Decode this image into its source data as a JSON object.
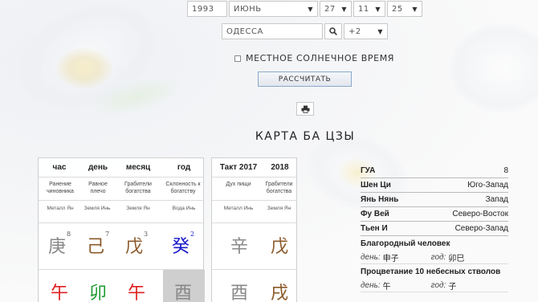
{
  "form": {
    "year": "1993",
    "month": "ИЮНЬ",
    "day": "27",
    "hour": "11",
    "minute": "25",
    "city": "ОДЕССА",
    "timezone": "+2",
    "local_solar_time_label": "МЕСТНОЕ СОЛНЕЧНОЕ ВРЕМЯ",
    "calculate_label": "РАССЧИТАТЬ"
  },
  "chart_title": "КАРТА БА ЦЗЫ",
  "pillars": {
    "headers": [
      "час",
      "день",
      "месяц",
      "год"
    ],
    "gods": [
      "Ранение чиновника",
      "Равное плечо",
      "Грабители богатства",
      "Склонность к богатству"
    ],
    "elements": [
      "Металл Ян",
      "Земля Инь",
      "Земля Ян",
      "Вода Инь"
    ],
    "stems": [
      {
        "char": "庚",
        "num": "8",
        "color": "#888888"
      },
      {
        "char": "己",
        "num": "7",
        "color": "#8b5a2b"
      },
      {
        "char": "戊",
        "num": "3",
        "color": "#8b5a2b"
      },
      {
        "char": "癸",
        "num": "2",
        "color": "#1a1acc"
      }
    ],
    "branches": [
      {
        "char": "午",
        "color": "#e02020"
      },
      {
        "char": "卯",
        "color": "#1f9a30"
      },
      {
        "char": "午",
        "color": "#e02020"
      },
      {
        "char": "酉",
        "color": "#888888"
      }
    ]
  },
  "luck": {
    "headers": [
      "Такт 2017",
      "2018"
    ],
    "gods": [
      "Дух пищи",
      "Грабители богатства"
    ],
    "elements": [
      "Металл Инь",
      "Земля Ян"
    ],
    "stems": [
      {
        "char": "辛",
        "color": "#888888"
      },
      {
        "char": "戊",
        "color": "#8b5a2b"
      }
    ],
    "branches": [
      {
        "char": "酉",
        "color": "#888888"
      },
      {
        "char": "戌",
        "color": "#8b5a2b"
      }
    ]
  },
  "info": {
    "rows": [
      {
        "k": "ГУА",
        "v": "8"
      },
      {
        "k": "Шен Ци",
        "v": "Юго-Запад"
      },
      {
        "k": "Янь Нянь",
        "v": "Запад"
      },
      {
        "k": "Фу Вей",
        "v": "Северо-Восток"
      },
      {
        "k": "Тьен И",
        "v": "Северо-Запад"
      }
    ],
    "noble_title": "Благородный человек",
    "noble_day_label": "день:",
    "noble_day_value": "申子",
    "noble_year_label": "год:",
    "noble_year_value": "卯巳",
    "prosperity_title": "Процветание 10 небесных стволов",
    "prosp_day_label": "день:",
    "prosp_day_value": "午",
    "prosp_year_label": "год:",
    "prosp_year_value": "子"
  }
}
